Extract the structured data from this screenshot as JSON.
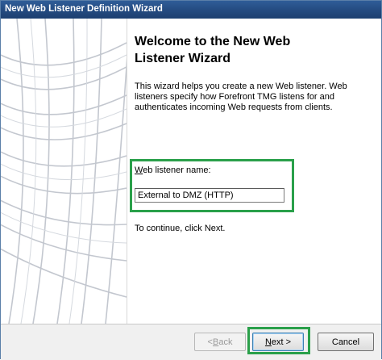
{
  "window": {
    "title": "New Web Listener Definition Wizard"
  },
  "main": {
    "heading_line1": "Welcome to the New Web",
    "heading_line2": "Listener Wizard",
    "intro": "This wizard helps you create a new Web listener. Web listeners specify how Forefront TMG listens for and authenticates incoming Web requests from clients.",
    "name_label_mnemonic": "W",
    "name_label_rest": "eb listener name:",
    "name_value": "External to DMZ (HTTP)",
    "continue_text": "To continue, click Next."
  },
  "buttons": {
    "back_arrow": "< ",
    "back_mnemonic": "B",
    "back_rest": "ack",
    "next_mnemonic": "N",
    "next_rest": "ext >",
    "cancel": "Cancel"
  },
  "colors": {
    "highlight": "#2aa04a",
    "titlebar": "#254c82"
  }
}
